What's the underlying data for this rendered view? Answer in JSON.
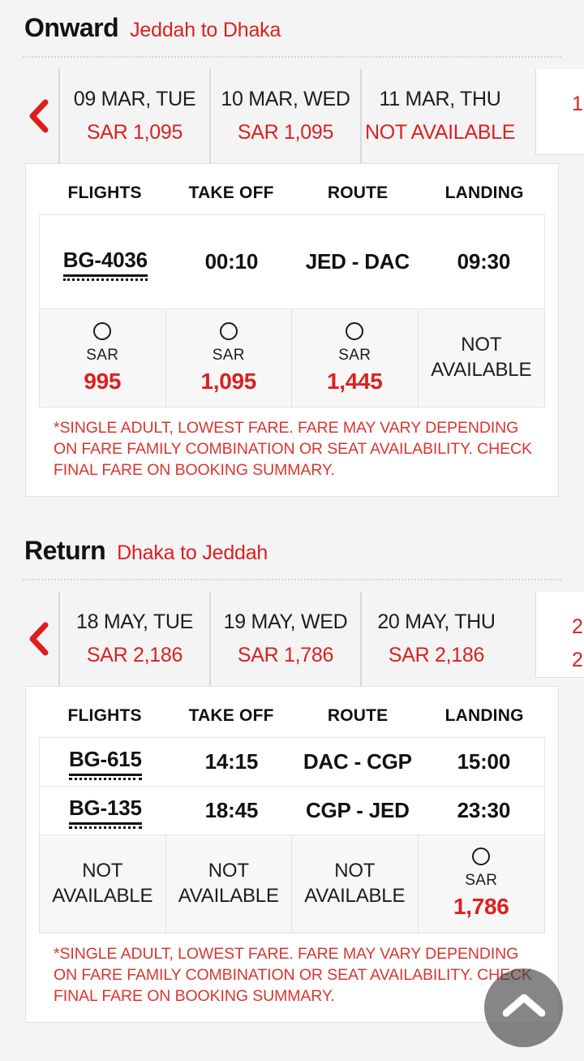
{
  "theme": {
    "accent_red": "#dc2020",
    "text_dark": "#111111",
    "page_bg": "#f4f4f4",
    "card_bg": "#ffffff",
    "fare_cell_bg": "#f7f7f7"
  },
  "onward": {
    "title": "Onward",
    "subtitle": "Jeddah to Dhaka",
    "prev_arrow_icon": "chevron-left-icon",
    "dates": [
      {
        "date": "09 MAR, TUE",
        "fare": "SAR 1,095"
      },
      {
        "date": "10 MAR, WED",
        "fare": "SAR 1,095"
      },
      {
        "date": "11 MAR, THU",
        "fare": "NOT AVAILABLE"
      }
    ],
    "selected_date": {
      "date": "1",
      "fare": ""
    },
    "table": {
      "headers": [
        "FLIGHTS",
        "TAKE OFF",
        "ROUTE",
        "LANDING"
      ],
      "rows": [
        {
          "flight": "BG-4036",
          "takeoff": "00:10",
          "route": "JED - DAC",
          "landing": "09:30"
        }
      ]
    },
    "fares": [
      {
        "available": true,
        "radio_icon": "radio-unchecked-icon",
        "currency": "SAR",
        "amount": "995",
        "na_label": ""
      },
      {
        "available": true,
        "radio_icon": "radio-unchecked-icon",
        "currency": "SAR",
        "amount": "1,095",
        "na_label": ""
      },
      {
        "available": true,
        "radio_icon": "radio-unchecked-icon",
        "currency": "SAR",
        "amount": "1,445",
        "na_label": ""
      },
      {
        "available": false,
        "radio_icon": "",
        "currency": "",
        "amount": "",
        "na_label": "NOT AVAILABLE"
      }
    ],
    "disclaimer": "*SINGLE ADULT, LOWEST FARE. FARE MAY VARY DEPENDING ON FARE FAMILY COMBINATION OR SEAT AVAILABILITY. CHECK FINAL FARE ON BOOKING SUMMARY."
  },
  "return": {
    "title": "Return",
    "subtitle": "Dhaka to Jeddah",
    "prev_arrow_icon": "chevron-left-icon",
    "dates": [
      {
        "date": "18 MAY, TUE",
        "fare": "SAR 2,186"
      },
      {
        "date": "19 MAY, WED",
        "fare": "SAR 1,786"
      },
      {
        "date": "20 MAY, THU",
        "fare": "SAR 2,186"
      }
    ],
    "selected_date": {
      "date": "2",
      "fare": "2"
    },
    "table": {
      "headers": [
        "FLIGHTS",
        "TAKE OFF",
        "ROUTE",
        "LANDING"
      ],
      "rows": [
        {
          "flight": "BG-615",
          "takeoff": "14:15",
          "route": "DAC - CGP",
          "landing": "15:00"
        },
        {
          "flight": "BG-135",
          "takeoff": "18:45",
          "route": "CGP - JED",
          "landing": "23:30"
        }
      ]
    },
    "fares": [
      {
        "available": false,
        "radio_icon": "",
        "currency": "",
        "amount": "",
        "na_label": "NOT AVAILABLE"
      },
      {
        "available": false,
        "radio_icon": "",
        "currency": "",
        "amount": "",
        "na_label": "NOT AVAILABLE"
      },
      {
        "available": false,
        "radio_icon": "",
        "currency": "",
        "amount": "",
        "na_label": "NOT AVAILABLE"
      },
      {
        "available": true,
        "radio_icon": "radio-unchecked-icon",
        "currency": "SAR",
        "amount": "1,786",
        "na_label": ""
      }
    ],
    "disclaimer": "*SINGLE ADULT, LOWEST FARE. FARE MAY VARY DEPENDING ON FARE FAMILY COMBINATION OR SEAT AVAILABILITY. CHECK FINAL FARE ON BOOKING SUMMARY."
  },
  "scroll_top_button": {
    "icon": "chevron-up-icon",
    "label": ""
  }
}
